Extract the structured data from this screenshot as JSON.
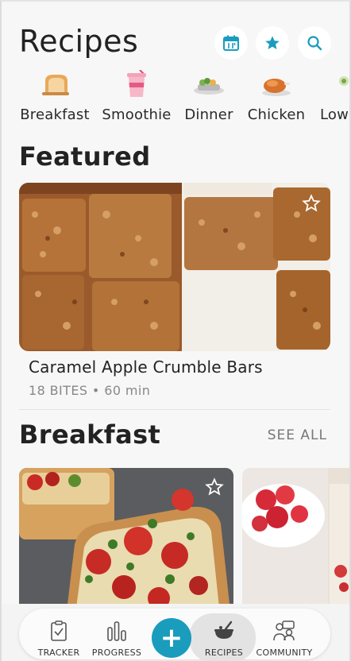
{
  "header": {
    "title": "Recipes",
    "icons": [
      "calendar-icon",
      "star-icon",
      "search-icon"
    ]
  },
  "categories": [
    {
      "label": "Breakfast",
      "icon": "bread-icon"
    },
    {
      "label": "Smoothie",
      "icon": "smoothie-icon"
    },
    {
      "label": "Dinner",
      "icon": "dinner-icon"
    },
    {
      "label": "Chicken",
      "icon": "chicken-icon"
    },
    {
      "label": "Low",
      "icon": "salad-icon"
    }
  ],
  "featured": {
    "section_title": "Featured",
    "recipe_name": "Caramel Apple Crumble Bars",
    "bites": "18 BITES",
    "separator": "•",
    "time": "60 min"
  },
  "breakfast": {
    "section_title": "Breakfast",
    "see_all": "SEE ALL"
  },
  "tabbar": {
    "tracker": "TRACKER",
    "progress": "PROGRESS",
    "add": "+",
    "recipes": "RECIPES",
    "community": "COMMUNITY",
    "active": "recipes"
  },
  "colors": {
    "accent": "#1a9cbd",
    "background": "#f7f7f7",
    "text": "#222222",
    "muted": "#888888"
  }
}
